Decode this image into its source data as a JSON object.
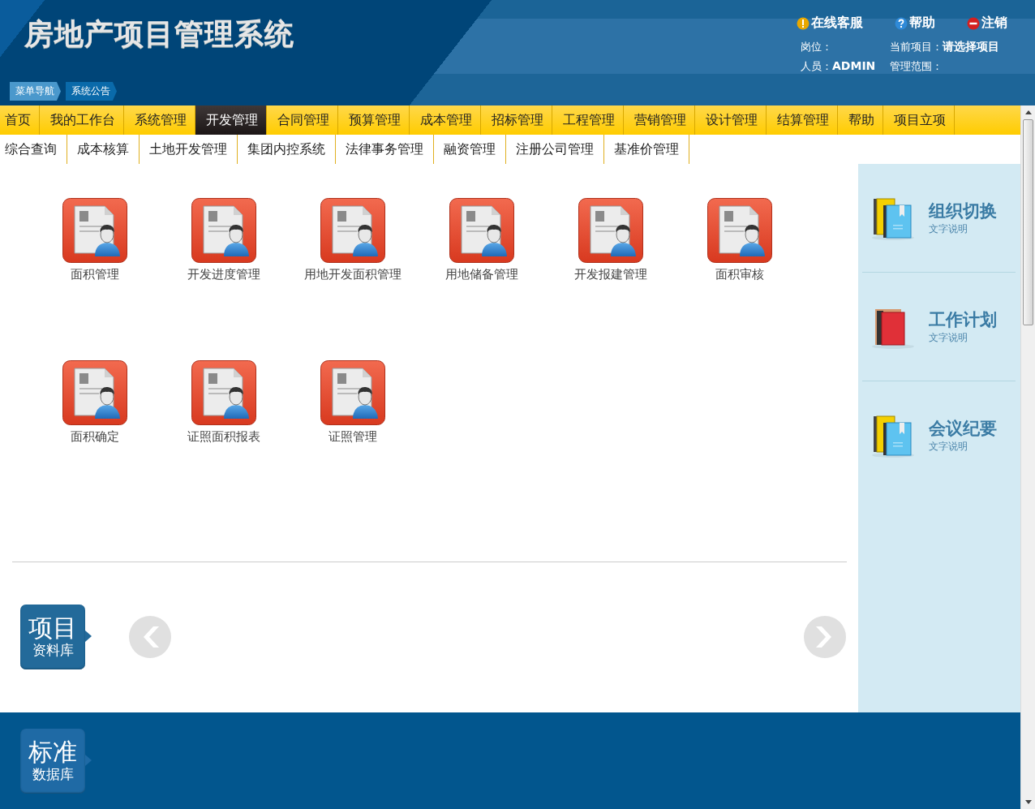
{
  "header": {
    "title": "房地产项目管理系统",
    "links": [
      {
        "label": "在线客服",
        "kind": "warning"
      },
      {
        "label": "帮助",
        "kind": "help"
      },
      {
        "label": "注销",
        "kind": "logout"
      }
    ],
    "info": [
      {
        "label": "岗位："
      },
      {
        "label": "当前项目：",
        "value": "请选择项目"
      },
      {
        "label": "人员：",
        "value": "ADMIN"
      },
      {
        "label": "管理范围："
      }
    ],
    "breadcrumbs": [
      {
        "label": "菜单导航",
        "selected": true
      },
      {
        "label": "系统公告",
        "selected": false
      }
    ]
  },
  "main_nav": [
    {
      "label": "首页",
      "selected": false
    },
    {
      "label": "我的工作台",
      "selected": false
    },
    {
      "label": "系统管理",
      "selected": false
    },
    {
      "label": "开发管理",
      "selected": true
    },
    {
      "label": "合同管理",
      "selected": false
    },
    {
      "label": "预算管理",
      "selected": false
    },
    {
      "label": "成本管理",
      "selected": false
    },
    {
      "label": "招标管理",
      "selected": false
    },
    {
      "label": "工程管理",
      "selected": false
    },
    {
      "label": "营销管理",
      "selected": false
    },
    {
      "label": "设计管理",
      "selected": false
    },
    {
      "label": "结算管理",
      "selected": false
    },
    {
      "label": "帮助",
      "selected": false
    },
    {
      "label": "项目立项",
      "selected": false
    }
  ],
  "sub_nav": [
    {
      "label": "综合查询"
    },
    {
      "label": "成本核算"
    },
    {
      "label": "土地开发管理"
    },
    {
      "label": "集团内控系统"
    },
    {
      "label": "法律事务管理"
    },
    {
      "label": "融资管理"
    },
    {
      "label": "注册公司管理"
    },
    {
      "label": "基准价管理"
    }
  ],
  "modules": [
    {
      "label": "面积管理"
    },
    {
      "label": "开发进度管理"
    },
    {
      "label": "用地开发面积管理"
    },
    {
      "label": "用地储备管理"
    },
    {
      "label": "开发报建管理"
    },
    {
      "label": "面积审核"
    },
    {
      "label": "面积确定"
    },
    {
      "label": "证照面积报表"
    },
    {
      "label": "证照管理"
    }
  ],
  "carousel": {
    "title": "项目",
    "subtitle": "资料库"
  },
  "side_panel": [
    {
      "title": "组织切换",
      "subtitle": "文字说明",
      "kind": "bluebooks"
    },
    {
      "title": "工作计划",
      "subtitle": "文字说明",
      "kind": "redbook"
    },
    {
      "title": "会议纪要",
      "subtitle": "文字说明",
      "kind": "bluebooks"
    }
  ],
  "footer": {
    "title": "标准",
    "subtitle": "数据库"
  }
}
